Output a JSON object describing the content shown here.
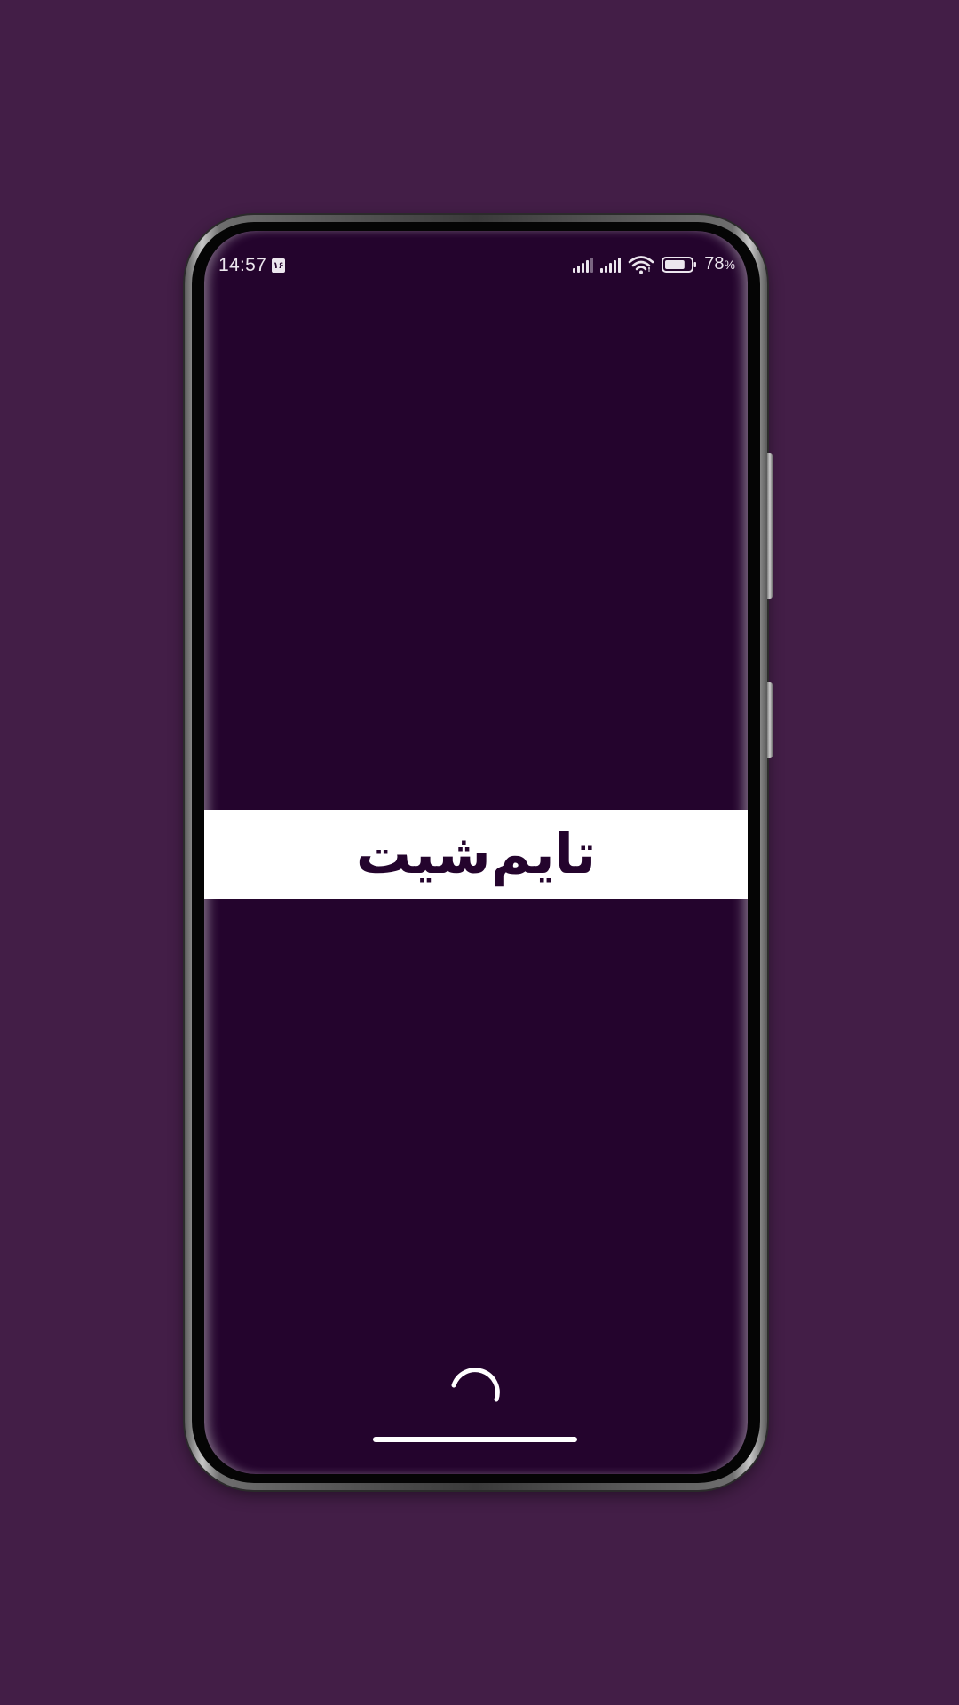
{
  "status_bar": {
    "time": "14:57",
    "calendar_day": "۱۶",
    "battery_percent": "78",
    "battery_symbol": "%",
    "battery_level": 0.78,
    "icons": [
      "signal-sim1-icon",
      "signal-sim2-icon",
      "wifi-icon",
      "battery-icon"
    ]
  },
  "splash": {
    "app_name": "تایم‌شیت"
  },
  "colors": {
    "page_background": "#431e47",
    "screen_background": "#24042d",
    "banner_background": "#ffffff",
    "title_text": "#24042d",
    "status_text": "#ece6ee"
  }
}
